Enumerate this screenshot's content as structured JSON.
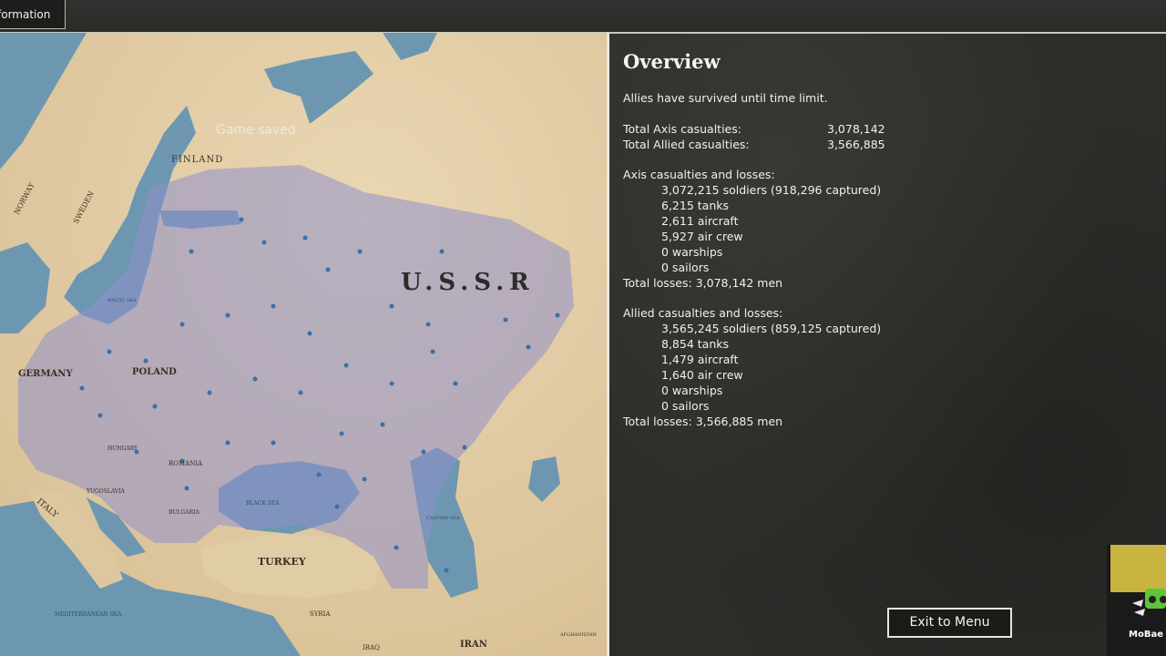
{
  "topbar": {
    "tab_label": "formation"
  },
  "map": {
    "toast": "Game saved",
    "labels": {
      "finland": "FINLAND",
      "norway": "NORWAY",
      "sweden": "SWEDEN",
      "ussr": "U.S.S.R",
      "germany": "GERMANY",
      "poland": "POLAND",
      "italy": "ITALY",
      "turkey": "TURKEY",
      "iran": "IRAN",
      "syria": "SYRIA",
      "iraq": "IRAQ",
      "romania": "ROMANIA",
      "yugoslavia": "YUGOSLAVIA",
      "hungary": "HUNGARY",
      "bulgaria": "BULGARIA",
      "black_sea": "BLACK SEA",
      "baltic_sea": "BALTIC SEA",
      "caspian_sea": "CASPIAN SEA",
      "mediterranean": "MEDITERRANEAN SEA",
      "afghanistan": "AFGHANISTAN"
    },
    "colors": {
      "land": "#e4cfa8",
      "sea": "#6b96b0",
      "front": "#8f8fc8"
    }
  },
  "overview": {
    "title": "Overview",
    "result": "Allies have survived until time limit.",
    "totals": {
      "axis_label": "Total Axis casualties:",
      "axis_value": "3,078,142",
      "allied_label": "Total Allied casualties:",
      "allied_value": "3,566,885"
    },
    "axis": {
      "header": "Axis casualties and losses:",
      "items": [
        "3,072,215 soldiers (918,296 captured)",
        "6,215 tanks",
        "2,611 aircraft",
        "5,927 air crew",
        "0 warships",
        "0 sailors"
      ],
      "total": "Total losses: 3,078,142 men"
    },
    "allied": {
      "header": "Allied casualties and losses:",
      "items": [
        "3,565,245 soldiers (859,125 captured)",
        "8,854 tanks",
        "1,479 aircraft",
        "1,640 air crew",
        "0 warships",
        "0 sailors"
      ],
      "total": "Total losses: 3,566,885 men"
    },
    "exit_label": "Exit to Menu"
  },
  "watermark": {
    "text": "MoBae"
  }
}
